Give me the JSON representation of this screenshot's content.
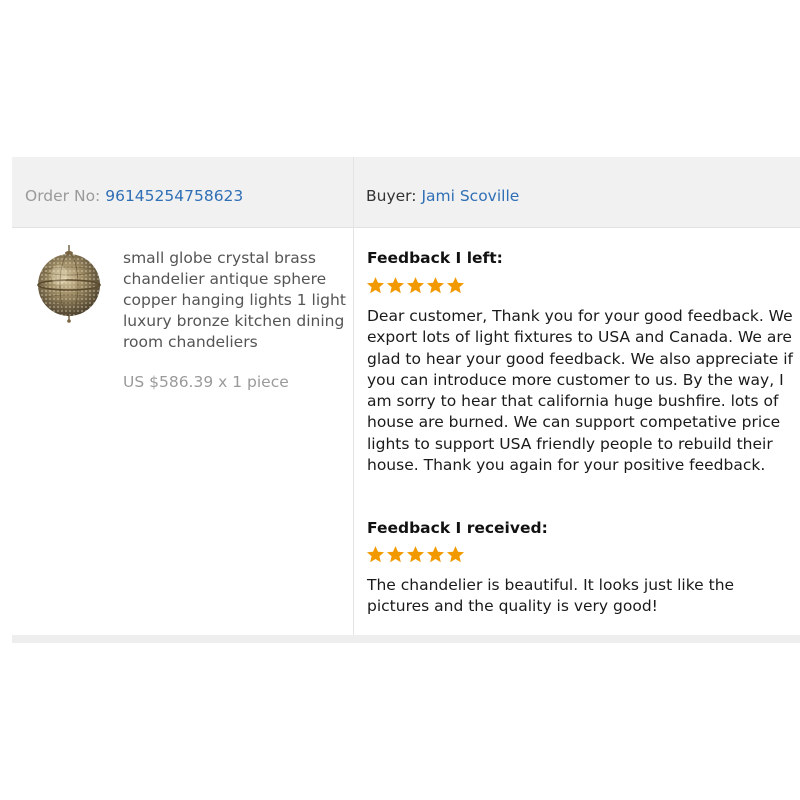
{
  "order": {
    "order_label": "Order No:",
    "order_number": "96145254758623",
    "buyer_label": "Buyer:",
    "buyer_name": "Jami Scoville"
  },
  "product": {
    "title": "small globe crystal brass chandelier antique sphere copper hanging lights 1 light luxury bronze kitchen dining room chandeliers",
    "price": "US $586.39 x 1 piece",
    "image_icon": "globe-chandelier-image"
  },
  "feedback_left": {
    "heading": "Feedback I left:",
    "rating": 5,
    "max_rating": 5,
    "text": "Dear customer, Thank you for your good feedback. We export lots of light fixtures to USA and Canada. We are glad to hear your good feedback. We also appreciate if you can introduce more customer to us. By the way, I am sorry to hear that california huge bushfire. lots of house are burned. We can support competative price lights to support USA friendly people to rebuild their house. Thank you again for your positive feedback."
  },
  "feedback_received": {
    "heading": "Feedback I received:",
    "rating": 5,
    "max_rating": 5,
    "text": "The chandelier is beautiful. It looks just like the pictures and the quality is very good!"
  },
  "colors": {
    "link": "#2f6fb5",
    "star": "#f29900",
    "header_bg": "#f1f1f1",
    "muted_text": "#9a9a9a"
  }
}
